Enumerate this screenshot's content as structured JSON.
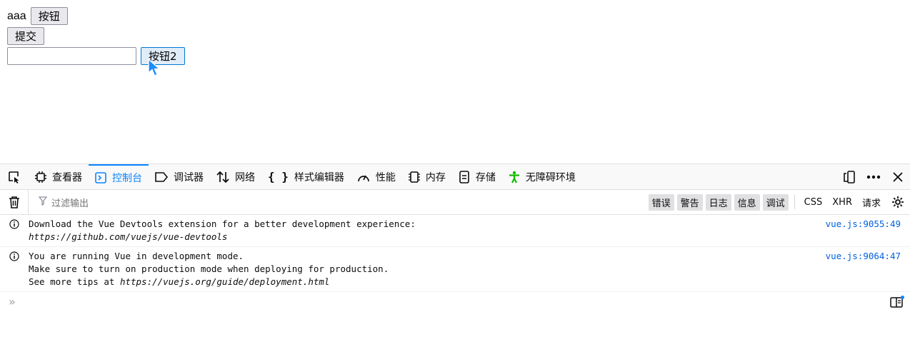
{
  "page": {
    "text_aaa": "aaa",
    "button1_label": "按钮",
    "submit_label": "提交",
    "text_input_value": "",
    "button2_label": "按钮2"
  },
  "devtools": {
    "tabs": [
      {
        "label": "查看器",
        "icon": "inspector-icon"
      },
      {
        "label": "控制台",
        "icon": "console-icon",
        "active": true
      },
      {
        "label": "调试器",
        "icon": "debugger-icon"
      },
      {
        "label": "网络",
        "icon": "network-icon"
      },
      {
        "label": "样式编辑器",
        "icon": "style-editor-icon"
      },
      {
        "label": "性能",
        "icon": "performance-icon"
      },
      {
        "label": "内存",
        "icon": "memory-icon"
      },
      {
        "label": "存储",
        "icon": "storage-icon"
      },
      {
        "label": "无障碍环境",
        "icon": "accessibility-icon"
      }
    ],
    "filter_placeholder": "过滤输出",
    "levels": [
      "错误",
      "警告",
      "日志",
      "信息",
      "调试"
    ],
    "extra_filters": [
      "CSS",
      "XHR",
      "请求"
    ],
    "messages": [
      {
        "lines": [
          "Download the Vue Devtools extension for a better development experience:",
          "https://github.com/vuejs/vue-devtools"
        ],
        "location": "vue.js:9055:49"
      },
      {
        "line1": "You are running Vue in development mode.",
        "line2": "Make sure to turn on production mode when deploying for production.",
        "line3_prefix": "See more tips at ",
        "line3_link": "https://vuejs.org/guide/deployment.html",
        "location": "vue.js:9064:47"
      }
    ],
    "prompt_symbol": "»"
  },
  "colors": {
    "accent": "#0a84ff",
    "link": "#0060df",
    "accessibility_green": "#12bc00"
  }
}
